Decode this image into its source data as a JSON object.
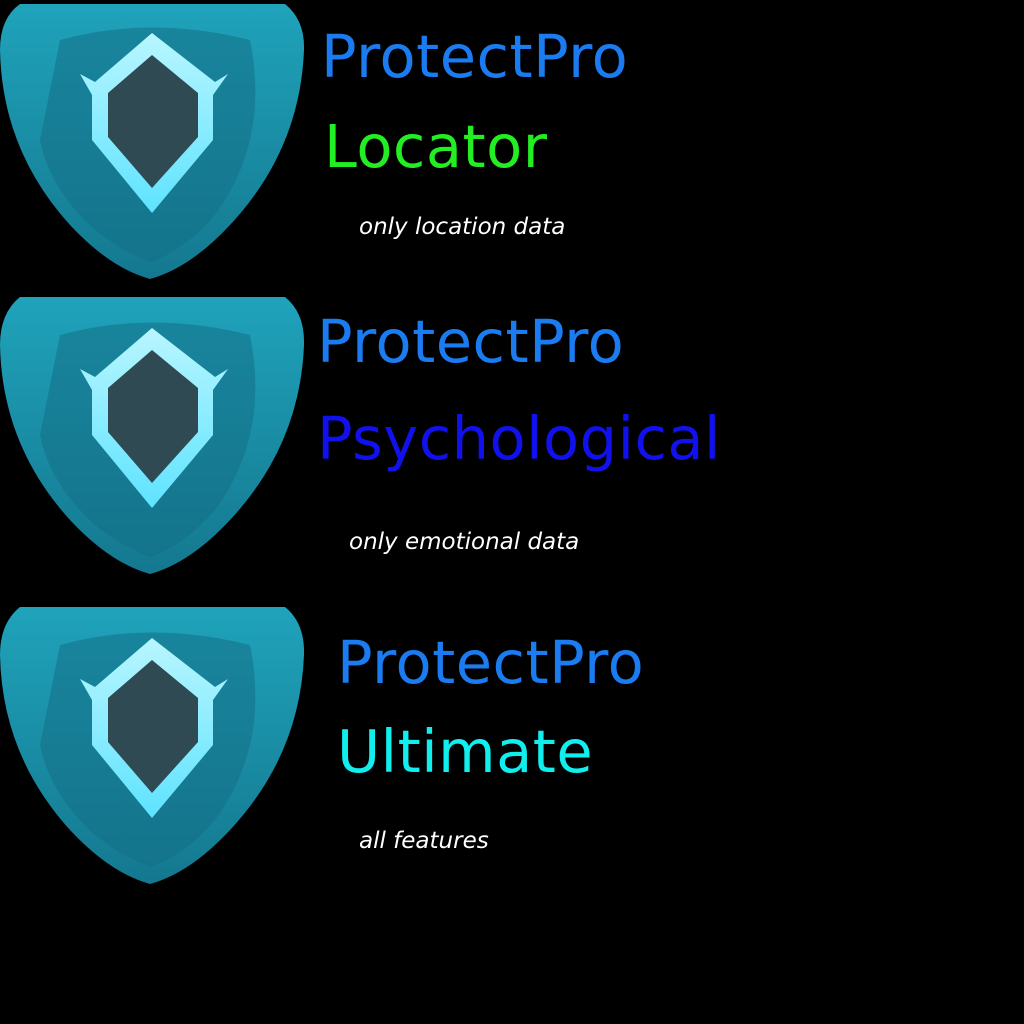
{
  "colors": {
    "background": "#000000",
    "brand_blue": "#1a7cf0",
    "locator_green": "#22ee22",
    "psychological_blue": "#1111ee",
    "ultimate_cyan": "#11eeee",
    "tagline_white": "#ffffff",
    "shield_teal": "#1a8fa6",
    "shield_dark_teal": "#146f86",
    "shield_emblem_glow": "#8ef0ff",
    "shield_emblem_fill": "#2f4a52"
  },
  "products": [
    {
      "icon": "shield-icon",
      "brand": "ProtectPro",
      "variant": "Locator",
      "tagline": "only location data"
    },
    {
      "icon": "shield-icon",
      "brand": "ProtectPro",
      "variant": "Psychological",
      "tagline": "only emotional data"
    },
    {
      "icon": "shield-icon",
      "brand": "ProtectPro",
      "variant": "Ultimate",
      "tagline": "all features"
    }
  ]
}
